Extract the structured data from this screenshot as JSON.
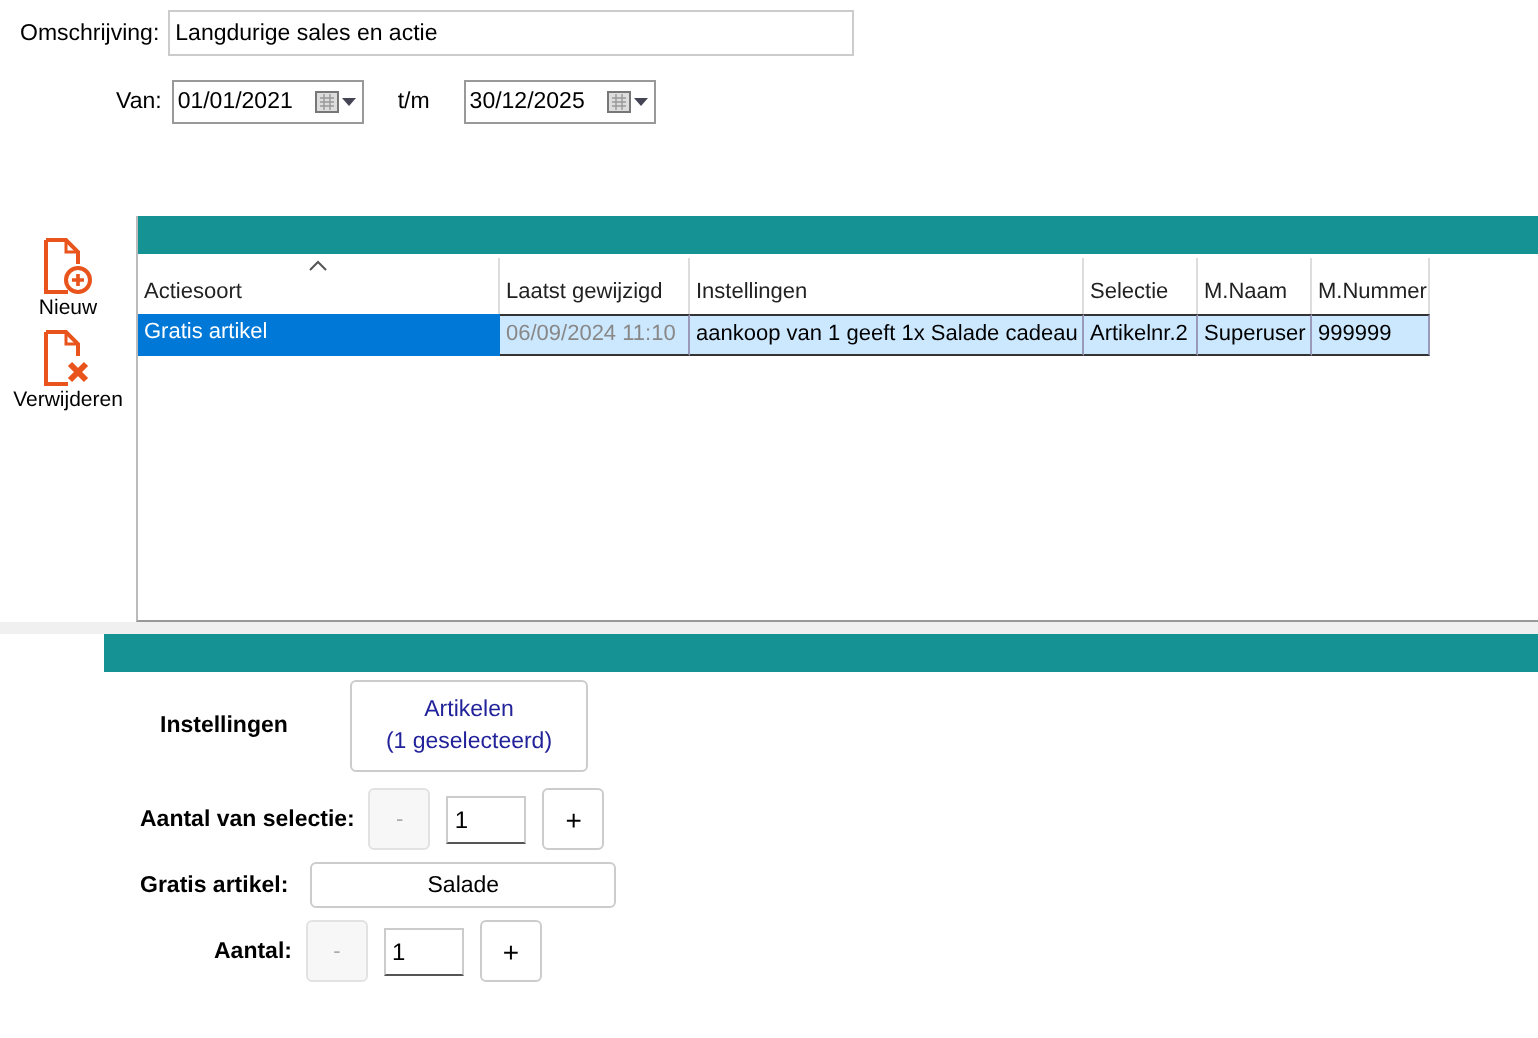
{
  "description": {
    "label": "Omschrijving:",
    "value": "Langdurige sales en actie"
  },
  "period": {
    "from_label": "Van:",
    "from": "01/01/2021",
    "to_label": "t/m",
    "to": "30/12/2025"
  },
  "toolbar": [
    {
      "kind": "new",
      "label": "Nieuw"
    },
    {
      "kind": "delete",
      "label": "Verwijderen"
    }
  ],
  "table": {
    "columns": [
      {
        "label": "Actiesoort",
        "sorted": true,
        "readonly": false
      },
      {
        "label": "Laatst gewijzigd",
        "sorted": false,
        "readonly": true
      },
      {
        "label": "Instellingen",
        "sorted": false,
        "readonly": false
      },
      {
        "label": "Selectie",
        "sorted": false,
        "readonly": false
      },
      {
        "label": "M.Naam",
        "sorted": false,
        "readonly": false
      },
      {
        "label": "M.Nummer",
        "sorted": false,
        "readonly": false
      }
    ],
    "rows": [
      {
        "selected": true,
        "cells": [
          "Gratis artikel",
          "06/09/2024 11:10",
          "aankoop van 1 geeft 1x Salade cadeau",
          "Artikelnr.2",
          "Superuser",
          "999999"
        ]
      }
    ]
  },
  "settings": {
    "label": "Instellingen",
    "button": "Artikelen\n(1 geselecteerd)",
    "fields": [
      {
        "kind": "stepper",
        "label": "Aantal van selectie:",
        "minus": "-",
        "minus_disabled": true,
        "value": "1",
        "plus": "+",
        "plus_disabled": false
      },
      {
        "kind": "picker",
        "label": "Gratis artikel:",
        "value": "Salade"
      },
      {
        "kind": "stepper",
        "label": "Aantal:",
        "minus": "-",
        "minus_disabled": true,
        "value": "1",
        "plus": "+",
        "plus_disabled": false
      }
    ]
  }
}
